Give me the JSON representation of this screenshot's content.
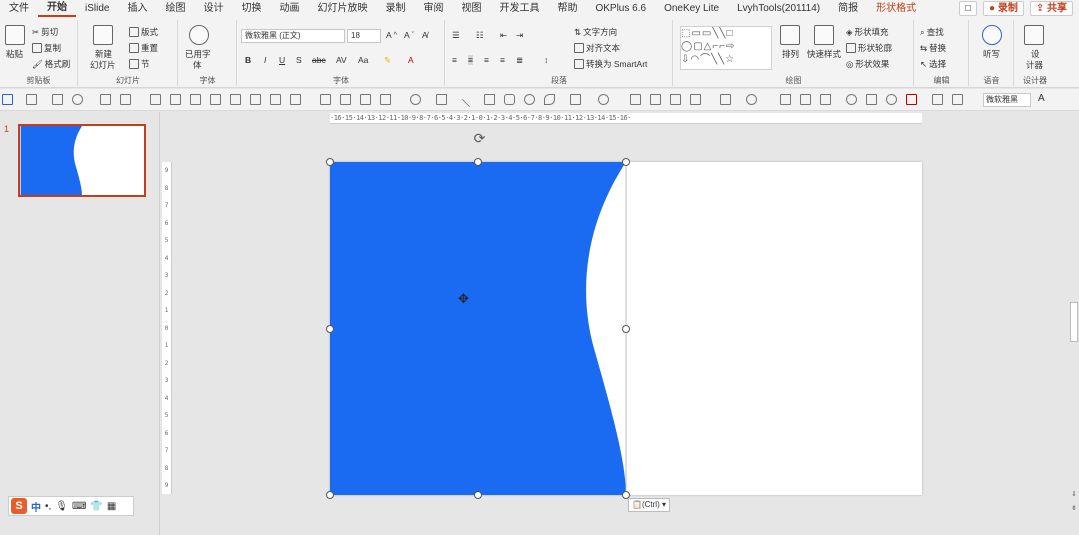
{
  "menu": {
    "tabs": [
      "文件",
      "开始",
      "iSlide",
      "插入",
      "绘图",
      "设计",
      "切换",
      "动画",
      "幻灯片放映",
      "录制",
      "审阅",
      "视图",
      "开发工具",
      "帮助",
      "OKPlus 6.6",
      "OneKey Lite",
      "LvyhTools(201114)",
      "简报",
      "形状格式"
    ],
    "active_tab": "开始",
    "record_label": "录制",
    "share_label": "共享"
  },
  "ribbon": {
    "clipboard": {
      "paste": "粘贴",
      "cut": "剪切",
      "copy": "复制",
      "format_painter": "格式刷",
      "label": "剪贴板"
    },
    "slides": {
      "new_slide": "新建",
      "new_slide2": "幻灯片",
      "layout": "版式",
      "reset": "重置",
      "section": "节",
      "label": "幻灯片"
    },
    "font_used": {
      "line1": "已用字",
      "line2": "体",
      "label": "字体"
    },
    "font": {
      "name": "微软雅黑 (正文)",
      "size": "18",
      "bold": "B",
      "italic": "I",
      "underline": "U",
      "strike": "S",
      "spacing": "AV",
      "case": "Aa",
      "label": "字体"
    },
    "paragraph": {
      "text_direction": "文字方向",
      "align_text": "对齐文本",
      "smartart": "转换为 SmartArt",
      "label": "段落"
    },
    "drawing": {
      "arrange": "排列",
      "quick_styles": "快速样式",
      "shape_fill": "形状填充",
      "shape_outline": "形状轮廓",
      "shape_effects": "形状效果",
      "label": "绘图"
    },
    "editing": {
      "find": "查找",
      "replace": "替换",
      "select": "选择",
      "label": "编辑"
    },
    "voice": {
      "dictate": "听写",
      "label": "语音"
    },
    "designer": {
      "line1": "设",
      "line2": "计器",
      "label": "设计器"
    }
  },
  "qat": {
    "font_name": "微软雅黑",
    "font_grow": "A"
  },
  "thumbnails": [
    {
      "number": "1"
    }
  ],
  "rulers": {
    "horizontal": "·16·15·14·13·12·11·10·9·8·7·6·5·4·3·2·1·0·1·2·3·4·5·6·7·8·9·10·11·12·13·14·15·16·",
    "vertical": [
      "9",
      "8",
      "7",
      "6",
      "5",
      "4",
      "3",
      "2",
      "1",
      "0",
      "1",
      "2",
      "3",
      "4",
      "5",
      "6",
      "7",
      "8",
      "9"
    ]
  },
  "shape": {
    "fill_color": "#1a6bf2",
    "slide_bg": "#ffffff"
  },
  "paste_options": {
    "label": "(Ctrl)"
  },
  "ime": {
    "logo": "S",
    "lang": "中"
  },
  "colors": {
    "accent": "#c43e1c",
    "shape_blue": "#1a6bf2"
  }
}
